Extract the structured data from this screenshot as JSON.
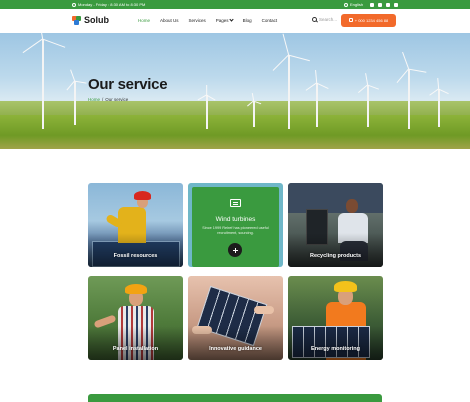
{
  "topbar": {
    "hours": "Monday - Friday : 8:30 AM to 8:30 PM",
    "language": "English"
  },
  "header": {
    "logo": "Solub",
    "nav": [
      {
        "label": "Home",
        "active": true
      },
      {
        "label": "About Us",
        "active": false
      },
      {
        "label": "Services",
        "active": false
      },
      {
        "label": "Pages",
        "active": false
      },
      {
        "label": "Blog",
        "active": false
      },
      {
        "label": "Contact",
        "active": false
      }
    ],
    "search_placeholder": "Search...",
    "cta": "+ 000 1234 456 88"
  },
  "hero": {
    "title": "Our service",
    "breadcrumb": [
      "Home",
      "/",
      "Our service"
    ]
  },
  "services": [
    {
      "label": "Fossil resources"
    },
    {
      "label": "Wind turbines",
      "description": "Since 1999 Reiref has pioneered useful recruitment, sourcing.",
      "featured": true
    },
    {
      "label": "Recycling products"
    },
    {
      "label": "Panel installation"
    },
    {
      "label": "Innovative guidance"
    },
    {
      "label": "Energy monitoring"
    }
  ],
  "colors": {
    "brand_green": "#3a9a3f",
    "accent_orange": "#f26a2b"
  }
}
